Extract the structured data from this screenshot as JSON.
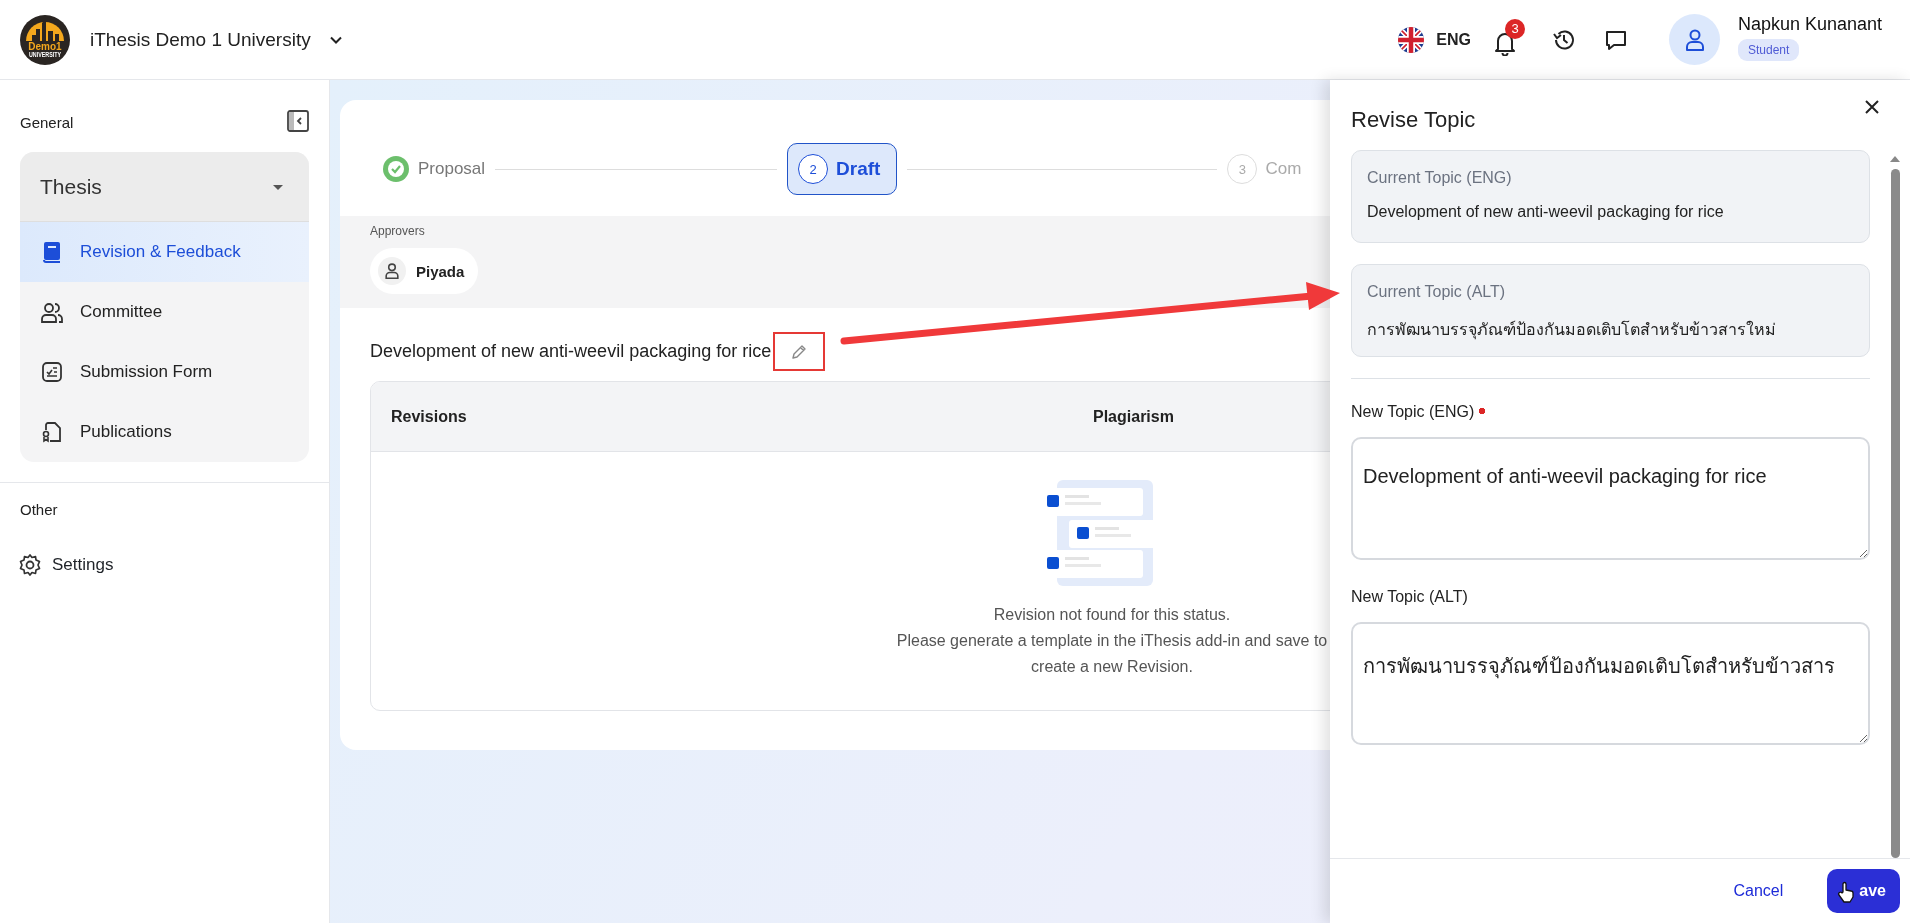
{
  "header": {
    "logo": {
      "text": "Demo1",
      "subtext": "UNIVERSITY"
    },
    "org_name": "iThesis Demo 1 University",
    "language": "ENG",
    "notification_count": "3",
    "user": {
      "name": "Napkun Kunanant",
      "role": "Student"
    }
  },
  "sidebar": {
    "sections": [
      {
        "title": "General",
        "group": {
          "label": "Thesis",
          "expanded": true,
          "items": [
            {
              "label": "Revision & Feedback",
              "selected": true
            },
            {
              "label": "Committee",
              "selected": false
            },
            {
              "label": "Submission Form",
              "selected": false
            },
            {
              "label": "Publications",
              "selected": false
            }
          ]
        }
      },
      {
        "title": "Other",
        "items": [
          {
            "label": "Settings",
            "selected": false
          }
        ]
      }
    ]
  },
  "stepper": [
    {
      "label": "Proposal",
      "completed": true,
      "selected": false
    },
    {
      "number": "2",
      "label": "Draft",
      "completed": false,
      "selected": true
    },
    {
      "number": "3",
      "label": "Com",
      "completed": false,
      "selected": false
    }
  ],
  "approvers": {
    "label": "Approvers",
    "people": [
      "Piyada"
    ]
  },
  "topic_title": "Development of new anti-weevil packaging for rice",
  "edit_highlighted": true,
  "pointer_arrow": true,
  "table": {
    "columns": [
      "Revisions",
      "Plagiarism"
    ],
    "empty_message": [
      "Revision not found for this status.",
      "Please generate a template in the iThesis add-in and save to",
      "create a new Revision."
    ]
  },
  "panel": {
    "title": "Revise Topic",
    "current": [
      {
        "label": "Current Topic (ENG)",
        "value": "Development of new anti-weevil packaging for rice"
      },
      {
        "label": "Current Topic (ALT)",
        "value": "การพัฒนาบรรจุภัณฑ์ป้องกันมอดเติบโตสำหรับข้าวสารใหม่"
      }
    ],
    "fields": [
      {
        "label": "New Topic (ENG)",
        "required": true,
        "value": "Development of anti-weevil packaging for rice"
      },
      {
        "label": "New Topic (ALT)",
        "required": false,
        "value": "การพัฒนาบรรจุภัณฑ์ป้องกันมอดเติบโตสำหรับข้าวสาร"
      }
    ],
    "cancel": "Cancel",
    "save": "ave"
  }
}
